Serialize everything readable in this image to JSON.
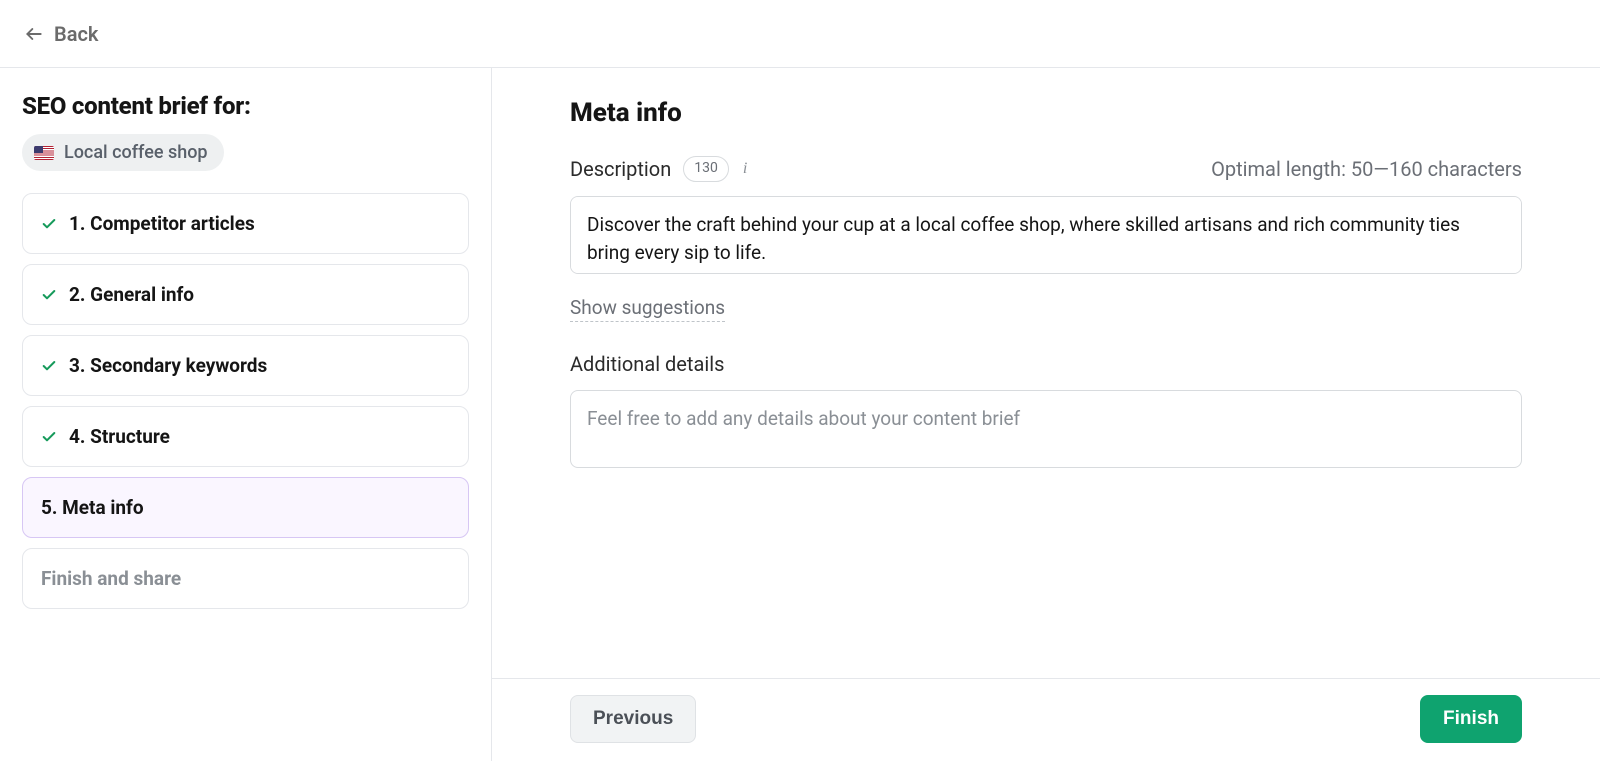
{
  "header": {
    "back_label": "Back"
  },
  "sidebar": {
    "title": "SEO content brief for:",
    "topic": "Local coffee shop",
    "steps": [
      {
        "label": "1. Competitor articles",
        "done": true
      },
      {
        "label": "2. General info",
        "done": true
      },
      {
        "label": "3. Secondary keywords",
        "done": true
      },
      {
        "label": "4. Structure",
        "done": true
      },
      {
        "label": "5. Meta info",
        "active": true
      }
    ],
    "finish_label": "Finish and share"
  },
  "meta": {
    "section_title": "Meta info",
    "description_label": "Description",
    "description_count": "130",
    "optimal_length": "Optimal length: 50—160 characters",
    "description_value": "Discover the craft behind your cup at a local coffee shop, where skilled artisans and rich community ties bring every sip to life.",
    "show_suggestions": "Show suggestions",
    "additional_label": "Additional details",
    "additional_placeholder": "Feel free to add any details about your content brief"
  },
  "footer": {
    "previous": "Previous",
    "finish": "Finish"
  }
}
